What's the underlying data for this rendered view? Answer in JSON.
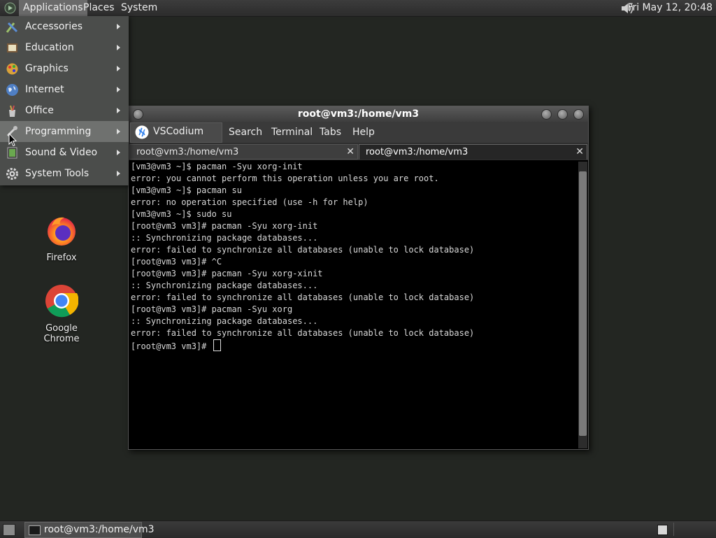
{
  "topbar": {
    "menus": [
      "Applications",
      "Places",
      "System"
    ],
    "clock": "Fri May 12, 20:48"
  },
  "desktop_icons": [
    {
      "label": "Firefox",
      "icon": "firefox-icon"
    },
    {
      "label": "Google Chrome",
      "icon": "chrome-icon"
    }
  ],
  "app_menu": {
    "items": [
      {
        "label": "Accessories",
        "icon": "accessories-icon"
      },
      {
        "label": "Education",
        "icon": "education-icon"
      },
      {
        "label": "Graphics",
        "icon": "graphics-icon"
      },
      {
        "label": "Internet",
        "icon": "internet-globe-icon"
      },
      {
        "label": "Office",
        "icon": "office-icon"
      },
      {
        "label": "Programming",
        "icon": "programming-icon"
      },
      {
        "label": "Sound & Video",
        "icon": "sound-video-icon"
      },
      {
        "label": "System Tools",
        "icon": "system-tools-gear-icon"
      }
    ],
    "highlighted": "Programming",
    "submenu_item": "VSCodium"
  },
  "terminal": {
    "title": "root@vm3:/home/vm3",
    "menubar": [
      "Search",
      "Terminal",
      "Tabs",
      "Help"
    ],
    "tabs": [
      {
        "label": "root@vm3:/home/vm3",
        "active": false
      },
      {
        "label": "root@vm3:/home/vm3",
        "active": true
      }
    ],
    "lines": [
      "[vm3@vm3 ~]$ pacman -Syu xorg-init",
      "error: you cannot perform this operation unless you are root.",
      "[vm3@vm3 ~]$ pacman su",
      "error: no operation specified (use -h for help)",
      "[vm3@vm3 ~]$ sudo su",
      "[root@vm3 vm3]# pacman -Syu xorg-init",
      ":: Synchronizing package databases...",
      "error: failed to synchronize all databases (unable to lock database)",
      "[root@vm3 vm3]# ^C",
      "[root@vm3 vm3]# pacman -Syu xorg-xinit",
      ":: Synchronizing package databases...",
      "error: failed to synchronize all databases (unable to lock database)",
      "[root@vm3 vm3]# pacman -Syu xorg",
      ":: Synchronizing package databases...",
      "error: failed to synchronize all databases (unable to lock database)"
    ],
    "prompt": "[root@vm3 vm3]# "
  },
  "taskbar": {
    "task_label": "root@vm3:/home/vm3"
  }
}
